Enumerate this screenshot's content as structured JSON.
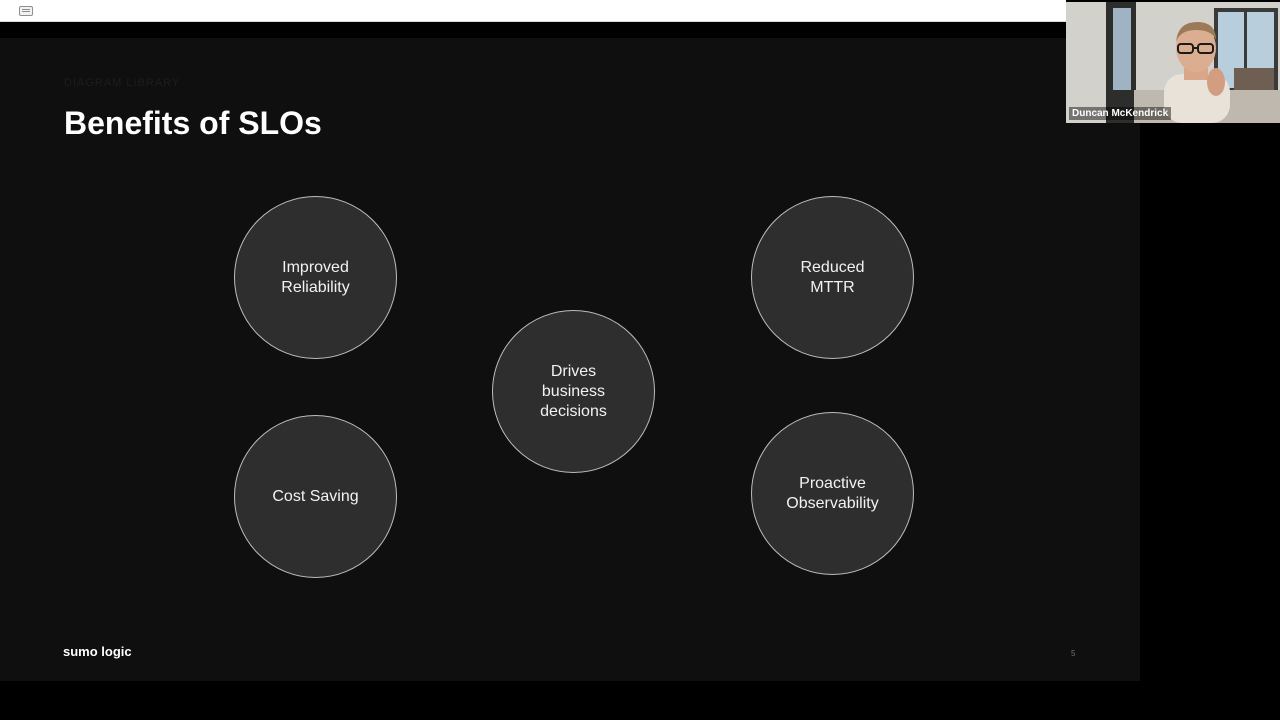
{
  "browser": {
    "tab_icon": "window-tab-icon"
  },
  "slide": {
    "eyebrow": "DIAGRAM LIBRARY",
    "title": "Benefits of SLOs",
    "benefits": [
      {
        "label": "Improved\nReliability"
      },
      {
        "label": "Reduced\nMTTR"
      },
      {
        "label": "Drives\nbusiness\ndecisions"
      },
      {
        "label": "Cost Saving"
      },
      {
        "label": "Proactive\nObservability"
      }
    ],
    "brand": "sumo logic",
    "page_number": "5"
  },
  "participant": {
    "name": "Duncan McKendrick"
  },
  "colors": {
    "slide_bg": "#0f0f0f",
    "bubble_fill": "#2e2e2e",
    "bubble_border": "#bdbdbd",
    "text": "#ffffff"
  }
}
